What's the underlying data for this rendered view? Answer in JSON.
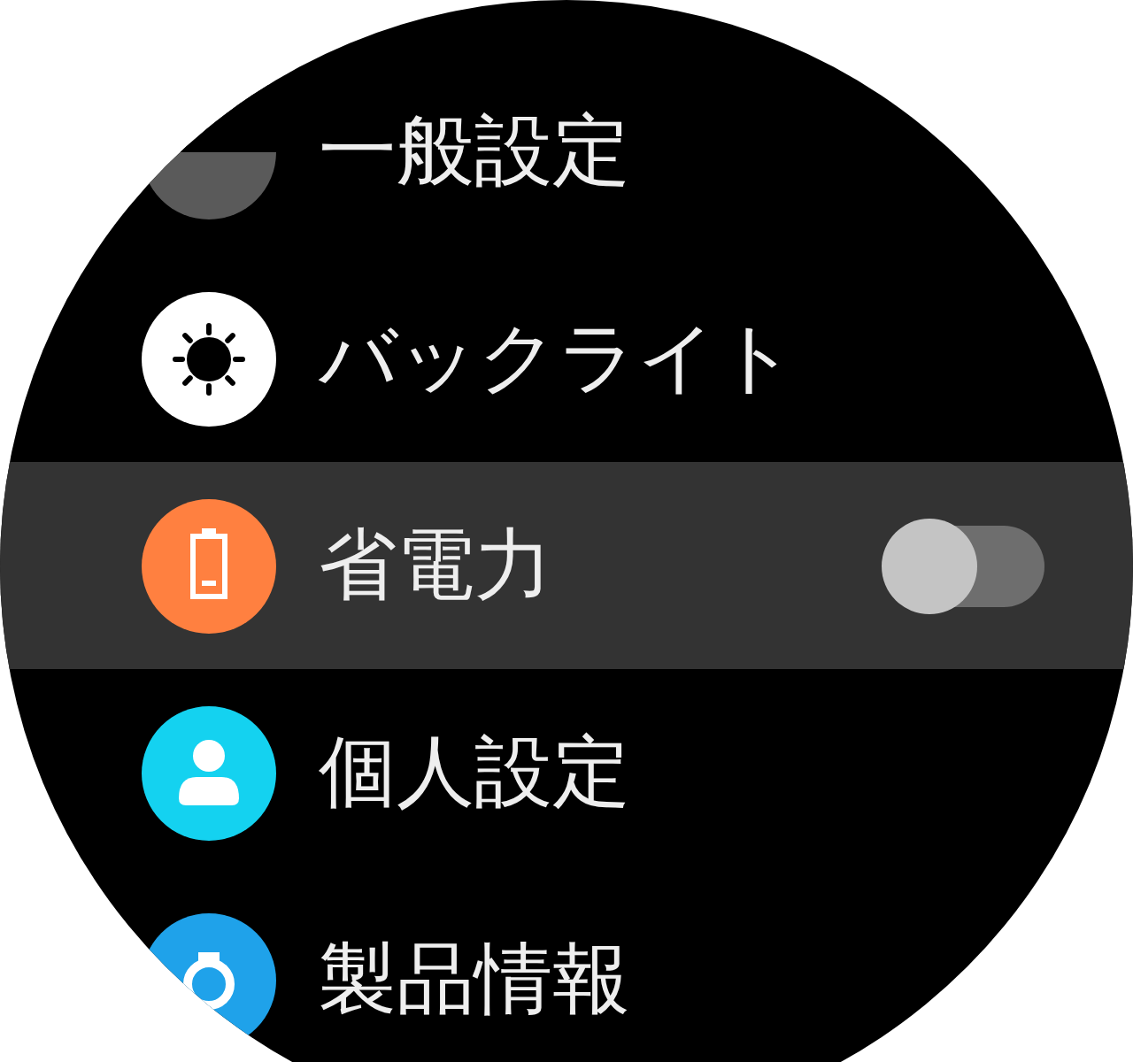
{
  "menu": [
    {
      "label": "一般設定",
      "kind": "general",
      "color": "#5a5a5a",
      "selected": false
    },
    {
      "label": "バックライト",
      "kind": "backlight",
      "color": "#ffffff",
      "selected": false
    },
    {
      "label": "省電力",
      "kind": "battery",
      "color": "#ff8040",
      "selected": true,
      "toggle": {
        "on": false
      }
    },
    {
      "label": "個人設定",
      "kind": "person",
      "color": "#14d2f0",
      "selected": false
    },
    {
      "label": "製品情報",
      "kind": "info",
      "color": "#1fa2ea",
      "selected": false
    }
  ]
}
